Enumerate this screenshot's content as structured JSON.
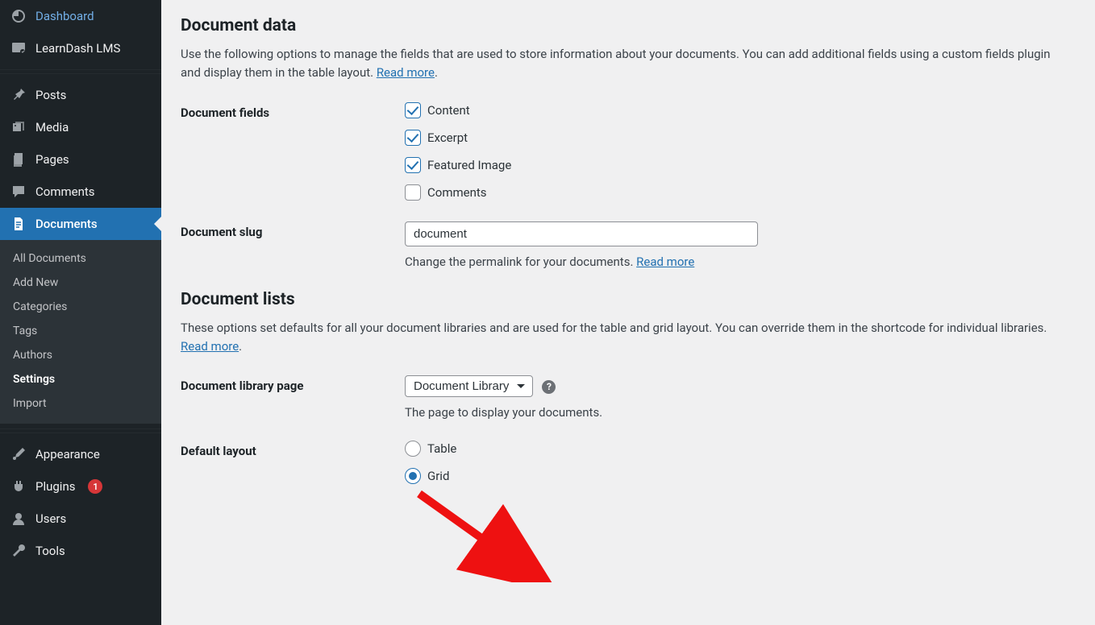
{
  "sidebar": {
    "items": [
      {
        "label": "Dashboard",
        "icon": "dashboard"
      },
      {
        "label": "LearnDash LMS",
        "icon": "learndash"
      },
      {
        "label": "Posts",
        "icon": "pin"
      },
      {
        "label": "Media",
        "icon": "media"
      },
      {
        "label": "Pages",
        "icon": "page"
      },
      {
        "label": "Comments",
        "icon": "comment"
      },
      {
        "label": "Documents",
        "icon": "document",
        "active": true
      },
      {
        "label": "Appearance",
        "icon": "brush"
      },
      {
        "label": "Plugins",
        "icon": "plug",
        "badge": "1"
      },
      {
        "label": "Users",
        "icon": "user"
      },
      {
        "label": "Tools",
        "icon": "wrench"
      }
    ],
    "submenu": [
      "All Documents",
      "Add New",
      "Categories",
      "Tags",
      "Authors",
      "Settings",
      "Import"
    ],
    "submenu_current": "Settings"
  },
  "section1": {
    "title": "Document data",
    "desc_a": "Use the following options to manage the fields that are used to store information about your documents. You can add additional fields using a custom fields plugin and display them in the table layout. ",
    "read_more": "Read more",
    "dot": "."
  },
  "fields_row": {
    "label": "Document fields",
    "opts": {
      "content": {
        "label": "Content",
        "checked": true
      },
      "excerpt": {
        "label": "Excerpt",
        "checked": true
      },
      "featured": {
        "label": "Featured Image",
        "checked": true
      },
      "comments": {
        "label": "Comments",
        "checked": false
      }
    }
  },
  "slug_row": {
    "label": "Document slug",
    "value": "document",
    "help_a": "Change the permalink for your documents. ",
    "read_more": "Read more"
  },
  "section2": {
    "title": "Document lists",
    "desc_a": "These options set defaults for all your document libraries and are used for the table and grid layout. You can override them in the shortcode for individual libraries. ",
    "read_more": "Read more",
    "dot": "."
  },
  "libpage_row": {
    "label": "Document library page",
    "selected": "Document Library",
    "help": "The page to display your documents."
  },
  "layout_row": {
    "label": "Default layout",
    "opts": {
      "table": {
        "label": "Table"
      },
      "grid": {
        "label": "Grid"
      }
    },
    "value": "grid"
  }
}
